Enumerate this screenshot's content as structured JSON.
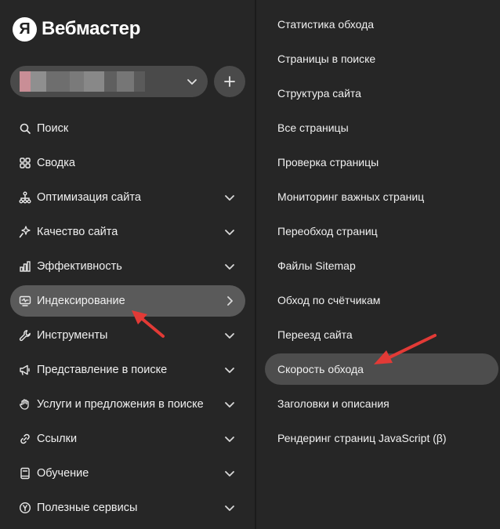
{
  "logo": {
    "mark": "Я",
    "text": "Вебмастер"
  },
  "site_select": {
    "icon": "chevron-down-icon"
  },
  "add_button": {
    "icon": "plus-icon"
  },
  "nav": [
    {
      "id": "search",
      "label": "Поиск",
      "icon": "search-icon",
      "chevron": "none"
    },
    {
      "id": "summary",
      "label": "Сводка",
      "icon": "grid-icon",
      "chevron": "none"
    },
    {
      "id": "optimization",
      "label": "Оптимизация сайта",
      "icon": "sitemap-icon",
      "chevron": "down"
    },
    {
      "id": "quality",
      "label": "Качество сайта",
      "icon": "sparkle-icon",
      "chevron": "down"
    },
    {
      "id": "efficiency",
      "label": "Эффективность",
      "icon": "bar-chart-icon",
      "chevron": "down"
    },
    {
      "id": "indexing",
      "label": "Индексирование",
      "icon": "monitor-pulse-icon",
      "chevron": "right",
      "active": true
    },
    {
      "id": "tools",
      "label": "Инструменты",
      "icon": "wrench-icon",
      "chevron": "down"
    },
    {
      "id": "representation",
      "label": "Представление в поиске",
      "icon": "megaphone-icon",
      "chevron": "down"
    },
    {
      "id": "services",
      "label": "Услуги и предложения в поиске",
      "icon": "hand-icon",
      "chevron": "down"
    },
    {
      "id": "links",
      "label": "Ссылки",
      "icon": "link-icon",
      "chevron": "down"
    },
    {
      "id": "learning",
      "label": "Обучение",
      "icon": "book-icon",
      "chevron": "down"
    },
    {
      "id": "useful",
      "label": "Полезные сервисы",
      "icon": "yandex-circle-icon",
      "chevron": "down"
    }
  ],
  "submenu": [
    {
      "label": "Статистика обхода"
    },
    {
      "label": "Страницы в поиске"
    },
    {
      "label": "Структура сайта"
    },
    {
      "label": "Все страницы"
    },
    {
      "label": "Проверка страницы"
    },
    {
      "label": "Мониторинг важных страниц"
    },
    {
      "label": "Переобход страниц"
    },
    {
      "label": "Файлы Sitemap"
    },
    {
      "label": "Обход по счётчикам"
    },
    {
      "label": "Переезд сайта"
    },
    {
      "label": "Скорость обхода",
      "active": true
    },
    {
      "label": "Заголовки и описания"
    },
    {
      "label": "Рендеринг страниц JavaScript (β)"
    }
  ],
  "colors": {
    "background": "#262626",
    "active_nav": "#5a5a5a",
    "active_sub": "#4d4d4d",
    "annotation_arrow": "#e23a36"
  }
}
